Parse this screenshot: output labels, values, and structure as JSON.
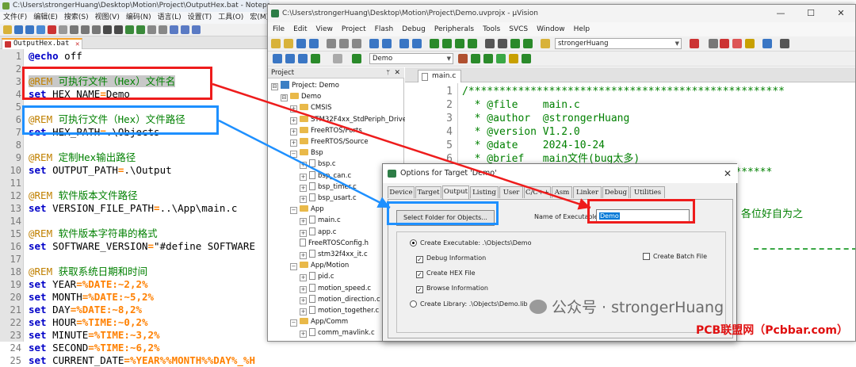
{
  "npp": {
    "title": "C:\\Users\\strongerHuang\\Desktop\\Motion\\Project\\OutputHex.bat - Notepad++ [Adm",
    "menu": [
      "文件(F)",
      "编辑(E)",
      "搜索(S)",
      "视图(V)",
      "编码(N)",
      "语言(L)",
      "设置(T)",
      "工具(O)",
      "宏(M)"
    ],
    "tab": "OutputHex.bat",
    "lines": [
      {
        "n": "1",
        "parts": [
          {
            "t": "@echo",
            "c": "kw"
          },
          {
            "t": " off",
            "c": ""
          }
        ]
      },
      {
        "n": "2",
        "parts": []
      },
      {
        "n": "3",
        "parts": [
          {
            "t": "@REM",
            "c": "at hl"
          },
          {
            "t": " 可执行文件（Hex）文件名",
            "c": "rem hl"
          }
        ]
      },
      {
        "n": "4",
        "parts": [
          {
            "t": "set",
            "c": "kw"
          },
          {
            "t": " HEX_NAME",
            "c": ""
          },
          {
            "t": "=",
            "c": "var"
          },
          {
            "t": "Demo",
            "c": ""
          }
        ]
      },
      {
        "n": "5",
        "parts": []
      },
      {
        "n": "6",
        "parts": [
          {
            "t": "@REM",
            "c": "at"
          },
          {
            "t": " 可执行文件（Hex）文件路径",
            "c": "rem"
          }
        ]
      },
      {
        "n": "7",
        "parts": [
          {
            "t": "set",
            "c": "kw"
          },
          {
            "t": " HEX_PATH",
            "c": ""
          },
          {
            "t": "=",
            "c": "var"
          },
          {
            "t": ".\\Objects",
            "c": ""
          }
        ]
      },
      {
        "n": "8",
        "parts": []
      },
      {
        "n": "9",
        "parts": [
          {
            "t": "@REM",
            "c": "at"
          },
          {
            "t": " 定制Hex输出路径",
            "c": "rem"
          }
        ]
      },
      {
        "n": "10",
        "parts": [
          {
            "t": "set",
            "c": "kw"
          },
          {
            "t": " OUTPUT_PATH",
            "c": ""
          },
          {
            "t": "=",
            "c": "var"
          },
          {
            "t": ".\\Output",
            "c": ""
          }
        ]
      },
      {
        "n": "11",
        "parts": []
      },
      {
        "n": "12",
        "parts": [
          {
            "t": "@REM",
            "c": "at"
          },
          {
            "t": " 软件版本文件路径",
            "c": "rem"
          }
        ]
      },
      {
        "n": "13",
        "parts": [
          {
            "t": "set",
            "c": "kw"
          },
          {
            "t": " VERSION_FILE_PATH",
            "c": ""
          },
          {
            "t": "=",
            "c": "var"
          },
          {
            "t": "..\\App\\main.c",
            "c": ""
          }
        ]
      },
      {
        "n": "14",
        "parts": []
      },
      {
        "n": "15",
        "parts": [
          {
            "t": "@REM",
            "c": "at"
          },
          {
            "t": " 软件版本字符串的格式",
            "c": "rem"
          }
        ]
      },
      {
        "n": "16",
        "parts": [
          {
            "t": "set",
            "c": "kw"
          },
          {
            "t": " SOFTWARE_VERSION",
            "c": ""
          },
          {
            "t": "=",
            "c": "var"
          },
          {
            "t": "\"#define SOFTWARE",
            "c": ""
          }
        ]
      },
      {
        "n": "17",
        "parts": []
      },
      {
        "n": "18",
        "parts": [
          {
            "t": "@REM",
            "c": "at"
          },
          {
            "t": " 获取系统日期和时间",
            "c": "rem"
          }
        ]
      },
      {
        "n": "19",
        "parts": [
          {
            "t": "set",
            "c": "kw"
          },
          {
            "t": " YEAR",
            "c": ""
          },
          {
            "t": "=%DATE:~2,2%",
            "c": "var"
          }
        ]
      },
      {
        "n": "20",
        "parts": [
          {
            "t": "set",
            "c": "kw"
          },
          {
            "t": " MONTH",
            "c": ""
          },
          {
            "t": "=%DATE:~5,2%",
            "c": "var"
          }
        ]
      },
      {
        "n": "21",
        "parts": [
          {
            "t": "set",
            "c": "kw"
          },
          {
            "t": " DAY",
            "c": ""
          },
          {
            "t": "=%DATE:~8,2%",
            "c": "var"
          }
        ]
      },
      {
        "n": "22",
        "parts": [
          {
            "t": "set",
            "c": "kw"
          },
          {
            "t": " HOUR",
            "c": ""
          },
          {
            "t": "=%TIME:~0,2%",
            "c": "var"
          }
        ]
      },
      {
        "n": "23",
        "parts": [
          {
            "t": "set",
            "c": "kw"
          },
          {
            "t": " MINUTE",
            "c": ""
          },
          {
            "t": "=%TIME:~3,2%",
            "c": "var"
          }
        ]
      },
      {
        "n": "24",
        "parts": [
          {
            "t": "set",
            "c": "kw"
          },
          {
            "t": " SECOND",
            "c": ""
          },
          {
            "t": "=%TIME:~6,2%",
            "c": "var"
          }
        ]
      },
      {
        "n": "25",
        "parts": [
          {
            "t": "set",
            "c": "kw"
          },
          {
            "t": " CURRENT_DATE",
            "c": ""
          },
          {
            "t": "=%YEAR%%MONTH%%DAY%_%H",
            "c": "var"
          }
        ]
      }
    ]
  },
  "uv": {
    "title": "C:\\Users\\strongerHuang\\Desktop\\Motion\\Project\\Demo.uvprojx - µVision",
    "window_controls": [
      "—",
      "☐",
      "✕"
    ],
    "menu": [
      "File",
      "Edit",
      "View",
      "Project",
      "Flash",
      "Debug",
      "Peripherals",
      "Tools",
      "SVCS",
      "Window",
      "Help"
    ],
    "toolbar_combo_search": "strongerHuang",
    "toolbar_combo_target": "Demo",
    "project_pane_title": "Project",
    "tree": [
      {
        "label": "Project: Demo",
        "kind": "root",
        "level": 0,
        "exp": "⊟"
      },
      {
        "label": "Demo",
        "kind": "proj",
        "level": 1,
        "exp": "⊟"
      },
      {
        "label": "CMSIS",
        "kind": "folder",
        "level": 2,
        "exp": "+"
      },
      {
        "label": "STM32F4xx_StdPeriph_Driver",
        "kind": "folder",
        "level": 2,
        "exp": "+"
      },
      {
        "label": "FreeRTOS/Ports",
        "kind": "folder",
        "level": 2,
        "exp": "+"
      },
      {
        "label": "FreeRTOS/Source",
        "kind": "folder",
        "level": 2,
        "exp": "+"
      },
      {
        "label": "Bsp",
        "kind": "folder",
        "level": 2,
        "exp": "−"
      },
      {
        "label": "bsp.c",
        "kind": "file",
        "level": 3,
        "exp": "+"
      },
      {
        "label": "bsp_can.c",
        "kind": "file",
        "level": 3,
        "exp": "+"
      },
      {
        "label": "bsp_timer.c",
        "kind": "file",
        "level": 3,
        "exp": "+"
      },
      {
        "label": "bsp_usart.c",
        "kind": "file",
        "level": 3,
        "exp": "+"
      },
      {
        "label": "App",
        "kind": "folder",
        "level": 2,
        "exp": "−"
      },
      {
        "label": "main.c",
        "kind": "file",
        "level": 3,
        "exp": "+"
      },
      {
        "label": "app.c",
        "kind": "file",
        "level": 3,
        "exp": "+"
      },
      {
        "label": "FreeRTOSConfig.h",
        "kind": "file",
        "level": 3,
        "exp": ""
      },
      {
        "label": "stm32f4xx_it.c",
        "kind": "file",
        "level": 3,
        "exp": "+"
      },
      {
        "label": "App/Motion",
        "kind": "folder",
        "level": 2,
        "exp": "−"
      },
      {
        "label": "pid.c",
        "kind": "file",
        "level": 3,
        "exp": "+"
      },
      {
        "label": "motion_speed.c",
        "kind": "file",
        "level": 3,
        "exp": "+"
      },
      {
        "label": "motion_direction.c",
        "kind": "file",
        "level": 3,
        "exp": "+"
      },
      {
        "label": "motion_together.c",
        "kind": "file",
        "level": 3,
        "exp": "+"
      },
      {
        "label": "App/Comm",
        "kind": "folder",
        "level": 2,
        "exp": "−"
      },
      {
        "label": "comm_mavlink.c",
        "kind": "file",
        "level": 3,
        "exp": "+"
      }
    ],
    "editor_tab": "main.c",
    "editor_lines": [
      {
        "n": "1",
        "text": "/***************************************************"
      },
      {
        "n": "2",
        "text": "  * @file    main.c"
      },
      {
        "n": "3",
        "text": "  * @author  @strongerHuang"
      },
      {
        "n": "4",
        "text": "  * @version V1.2.0"
      },
      {
        "n": "5",
        "text": "  * @date    2024-10-24"
      },
      {
        "n": "6",
        "text": "  * @brief   main文件(bug太多)"
      },
      {
        "n": "7",
        "text": "  ************************************************"
      }
    ],
    "side_text": "各位好自为之"
  },
  "dialog": {
    "title": "Options for Target 'Demo'",
    "close": "✕",
    "tabs": [
      "Device",
      "Target",
      "Output",
      "Listing",
      "User",
      "C/C++",
      "Asm",
      "Linker",
      "Debug",
      "Utilities"
    ],
    "active_tab": "Output",
    "select_folder_button": "Select Folder for Objects...",
    "name_label": "Name of Executable:",
    "name_value": "Demo",
    "create_exec": "Create Executable:  .\\Objects\\Demo",
    "debug_info": "Debug Information",
    "create_hex": "Create HEX File",
    "browse_info": "Browse Information",
    "create_batch": "Create Batch File",
    "create_lib": "Create Library:  .\\Objects\\Demo.lib"
  },
  "watermark": {
    "wechat": "公众号 · strongerHuang",
    "pcb": "PCB联盟网（Pcbbar.com）"
  },
  "colors": {
    "annotation_red": "#ee1c1c",
    "annotation_blue": "#1e90ff",
    "comment_green": "#008000",
    "keyword_blue": "#0000c8",
    "variable_orange": "#ff8000"
  }
}
